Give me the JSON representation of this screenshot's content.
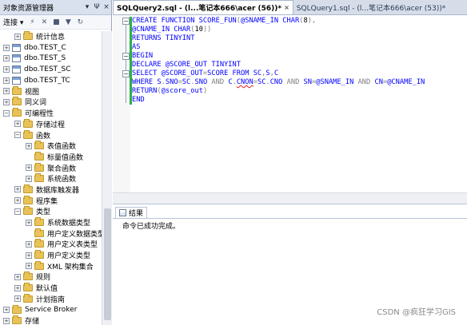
{
  "object_explorer": {
    "title": "对象资源管理器",
    "title_buttons": [
      "▾",
      "Ψ",
      "×"
    ],
    "toolbar": {
      "connect_label": "连接 ▾"
    },
    "tree": [
      {
        "indent": 1,
        "expander": "+",
        "icon": "folder",
        "label": "统计信息"
      },
      {
        "indent": 0,
        "expander": "+",
        "icon": "table",
        "label": "dbo.TEST_C"
      },
      {
        "indent": 0,
        "expander": "+",
        "icon": "table",
        "label": "dbo.TEST_S"
      },
      {
        "indent": 0,
        "expander": "+",
        "icon": "table",
        "label": "dbo.TEST_SC"
      },
      {
        "indent": 0,
        "expander": "+",
        "icon": "table",
        "label": "dbo.TEST_TC"
      },
      {
        "indent": 0,
        "expander": "+",
        "icon": "folder",
        "label": "视图"
      },
      {
        "indent": 0,
        "expander": "+",
        "icon": "folder",
        "label": "同义词"
      },
      {
        "indent": 0,
        "expander": "−",
        "icon": "folder",
        "label": "可编程性"
      },
      {
        "indent": 1,
        "expander": "+",
        "icon": "folder",
        "label": "存储过程"
      },
      {
        "indent": 1,
        "expander": "−",
        "icon": "folder",
        "label": "函数"
      },
      {
        "indent": 2,
        "expander": "+",
        "icon": "folder",
        "label": "表值函数"
      },
      {
        "indent": 2,
        "expander": "",
        "icon": "folder",
        "label": "标量值函数"
      },
      {
        "indent": 2,
        "expander": "+",
        "icon": "folder",
        "label": "聚合函数"
      },
      {
        "indent": 2,
        "expander": "+",
        "icon": "folder",
        "label": "系统函数"
      },
      {
        "indent": 1,
        "expander": "+",
        "icon": "folder",
        "label": "数据库触发器"
      },
      {
        "indent": 1,
        "expander": "+",
        "icon": "folder",
        "label": "程序集"
      },
      {
        "indent": 1,
        "expander": "−",
        "icon": "folder",
        "label": "类型"
      },
      {
        "indent": 2,
        "expander": "+",
        "icon": "folder",
        "label": "系统数据类型"
      },
      {
        "indent": 2,
        "expander": "",
        "icon": "folder",
        "label": "用户定义数据类型"
      },
      {
        "indent": 2,
        "expander": "+",
        "icon": "folder",
        "label": "用户定义表类型"
      },
      {
        "indent": 2,
        "expander": "+",
        "icon": "folder",
        "label": "用户定义类型"
      },
      {
        "indent": 2,
        "expander": "+",
        "icon": "folder",
        "label": "XML 架构集合"
      },
      {
        "indent": 1,
        "expander": "+",
        "icon": "folder",
        "label": "规则"
      },
      {
        "indent": 1,
        "expander": "+",
        "icon": "folder",
        "label": "默认值"
      },
      {
        "indent": 1,
        "expander": "+",
        "icon": "folder",
        "label": "计划指南"
      },
      {
        "indent": 0,
        "expander": "+",
        "icon": "folder",
        "label": "Service Broker"
      },
      {
        "indent": 0,
        "expander": "+",
        "icon": "folder",
        "label": "存储"
      }
    ]
  },
  "tabs": [
    {
      "label": "SQLQuery2.sql - (l...笔记本666\\acer (56))*",
      "active": true,
      "close": "×"
    },
    {
      "label": "SQLQuery1.sql - (l...笔记本666\\acer (53))*",
      "active": false,
      "close": ""
    }
  ],
  "code_lines": [
    [
      [
        "kw",
        "CREATE FUNCTION SCORE_FUN"
      ],
      [
        "gr",
        "("
      ],
      [
        "kw",
        "@SNAME_IN CHAR"
      ],
      [
        "gr",
        "("
      ],
      [
        "bk",
        "8"
      ],
      [
        "gr",
        "),"
      ]
    ],
    [
      [
        "kw",
        "@CNAME_IN CHAR"
      ],
      [
        "gr",
        "("
      ],
      [
        "bk",
        "10"
      ],
      [
        "gr",
        "))"
      ]
    ],
    [
      [
        "kw",
        "RETURNS TINYINT"
      ]
    ],
    [
      [
        "kw",
        "AS"
      ]
    ],
    [
      [
        "kw",
        "BEGIN"
      ]
    ],
    [
      [
        "kw",
        "DECLARE @SCORE_OUT TINYINT"
      ]
    ],
    [
      [
        "kw",
        "SELECT @SCORE_OUT"
      ],
      [
        "gr",
        "="
      ],
      [
        "kw",
        "SCORE FROM SC"
      ],
      [
        "gr",
        ","
      ],
      [
        "kw",
        "S"
      ],
      [
        "gr",
        ","
      ],
      [
        "kw",
        "C"
      ]
    ],
    [
      [
        "kw",
        "WHERE S"
      ],
      [
        "gr",
        "."
      ],
      [
        "kw",
        "SNO"
      ],
      [
        "gr",
        "="
      ],
      [
        "kw",
        "SC"
      ],
      [
        "gr",
        "."
      ],
      [
        "kw",
        "SNO "
      ],
      [
        "gr",
        "AND"
      ],
      [
        "kw",
        " C"
      ],
      [
        "gr",
        "."
      ],
      [
        "sq",
        "CNON"
      ],
      [
        "gr",
        "="
      ],
      [
        "kw",
        "SC"
      ],
      [
        "gr",
        "."
      ],
      [
        "kw",
        "CNO "
      ],
      [
        "gr",
        "AND"
      ],
      [
        "kw",
        " SN"
      ],
      [
        "gr",
        "="
      ],
      [
        "kw",
        "@SNAME_IN "
      ],
      [
        "gr",
        "AND"
      ],
      [
        "kw",
        " CN"
      ],
      [
        "gr",
        "="
      ],
      [
        "kw",
        "@CNAME_IN"
      ]
    ],
    [
      [
        "kw",
        "RETURN"
      ],
      [
        "gr",
        "("
      ],
      [
        "kw",
        "@score_out"
      ],
      [
        "gr",
        ")"
      ]
    ],
    [
      [
        "kw",
        "END"
      ]
    ]
  ],
  "results": {
    "tab_label": "结果",
    "message": "命令已成功完成。"
  },
  "watermark": "CSDN @疯狂学习GIS",
  "colors": {
    "keyword": "#0000ff",
    "operator": "#808080",
    "number": "#000000",
    "error_underline": "#e02020"
  }
}
